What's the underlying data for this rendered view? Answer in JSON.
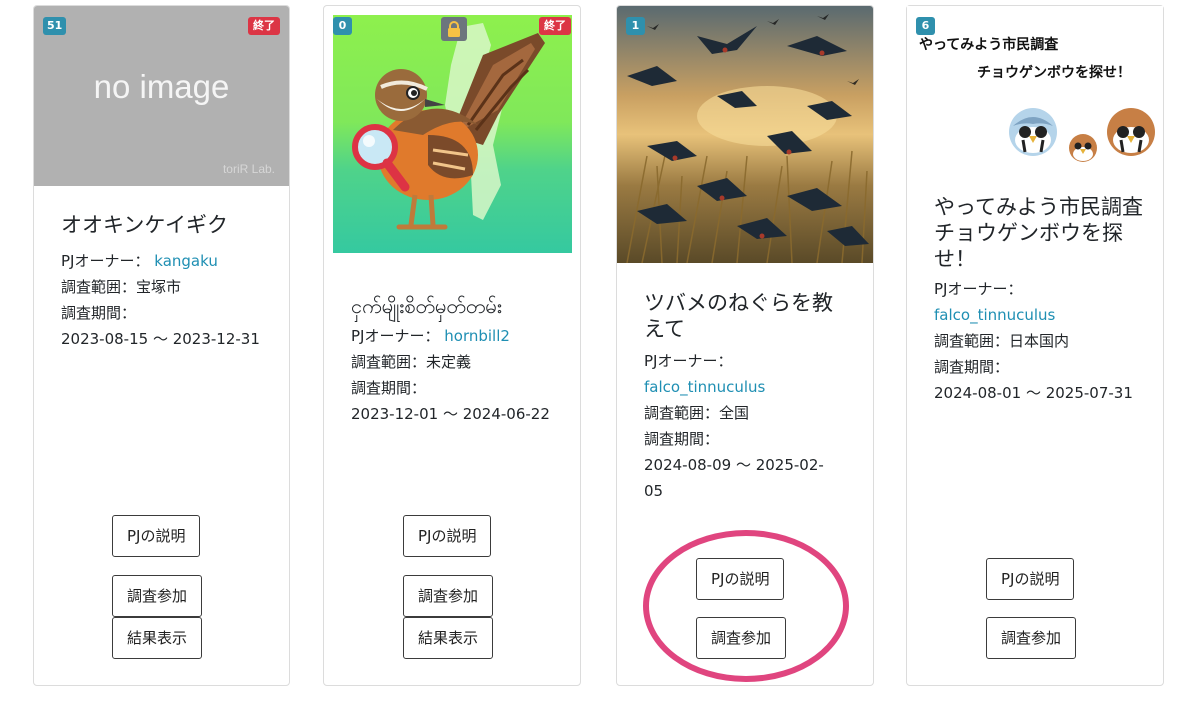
{
  "cards": [
    {
      "count": "51",
      "status": "終了",
      "placeholder": {
        "text": "no image",
        "credit": "toriR Lab."
      },
      "title": "オオキンケイギク",
      "owner_label": "PJオーナー：",
      "owner": "kangaku",
      "range_label": "調査範囲：",
      "range": "宝塚市",
      "period_label": "調査期間：",
      "period": "2023-08-15 〜 2023-12-31",
      "buttons": {
        "description": "PJの説明",
        "join": "調査参加",
        "results": "結果表示"
      }
    },
    {
      "count": "0",
      "status": "終了",
      "title": "ငှက်မျိုးစိတ်မှတ်တမ်း",
      "owner_label": "PJオーナー：",
      "owner": "hornbill2",
      "range_label": "調査範囲：",
      "range": "未定義",
      "period_label": "調査期間：",
      "period": "2023-12-01 〜 2024-06-22",
      "buttons": {
        "description": "PJの説明",
        "join": "調査参加",
        "results": "結果表示"
      }
    },
    {
      "count": "1",
      "title": "ツバメのねぐらを教えて",
      "owner_label": "PJオーナー：",
      "owner": "falco_tinnuculus",
      "range_label": "調査範囲：",
      "range": "全国",
      "period_label": "調査期間：",
      "period": "2024-08-09 〜 2025-02-05",
      "buttons": {
        "description": "PJの説明",
        "join": "調査参加"
      }
    },
    {
      "count": "6",
      "promo": {
        "line1": "やってみよう市民調査",
        "line2": "チョウゲンボウを探せ！"
      },
      "title": "やってみよう市民調査　チョウゲンボウを探せ！",
      "owner_label": "PJオーナー：",
      "owner": "falco_tinnuculus",
      "range_label": "調査範囲：",
      "range": "日本国内",
      "period_label": "調査期間：",
      "period": "2024-08-01 〜 2025-07-31",
      "buttons": {
        "description": "PJの説明",
        "join": "調査参加"
      }
    }
  ],
  "colors": {
    "badge_count": "#2f90ad",
    "badge_ended": "#dc3545",
    "link": "#1f8fb3",
    "highlight": "#e0457f"
  },
  "icons": [
    "lock-icon",
    "bird-magnifier-illustration",
    "swallows-photo",
    "kestrel-face-icon"
  ]
}
